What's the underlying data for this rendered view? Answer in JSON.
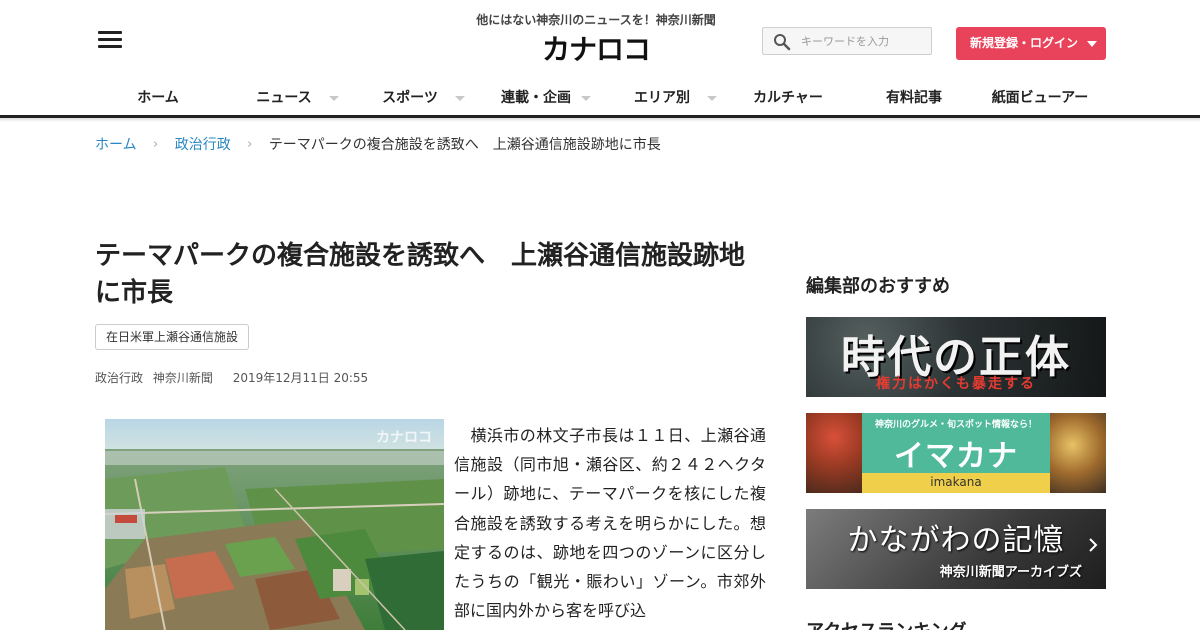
{
  "header": {
    "tagline": "他にはない神奈川のニュースを！神奈川新聞",
    "logo": "カナロコ",
    "search_placeholder": "キーワードを入力",
    "login_label": "新規登録・ログイン"
  },
  "nav": [
    {
      "label": "ホーム",
      "dropdown": false
    },
    {
      "label": "ニュース",
      "dropdown": true
    },
    {
      "label": "スポーツ",
      "dropdown": true
    },
    {
      "label": "連載・企画",
      "dropdown": true
    },
    {
      "label": "エリア別",
      "dropdown": true
    },
    {
      "label": "カルチャー",
      "dropdown": false
    },
    {
      "label": "有料記事",
      "dropdown": false
    },
    {
      "label": "紙面ビューアー",
      "dropdown": false
    }
  ],
  "breadcrumb": {
    "home": "ホーム",
    "category": "政治行政",
    "current": "テーマパークの複合施設を誘致へ　上瀬谷通信施設跡地に市長"
  },
  "article": {
    "title": "テーマパークの複合施設を誘致へ　上瀬谷通信施設跡地に市長",
    "tag": "在日米軍上瀬谷通信施設",
    "category": "政治行政",
    "source": "神奈川新聞",
    "date": "2019年12月11日 20:55",
    "photo_watermark": "カナロコ",
    "body": "　横浜市の林文子市長は１１日、上瀬谷通信施設（同市旭・瀬谷区、約２４２ヘクタール）跡地に、テーマパークを核にした複合施設を誘致する考えを明らかにした。想定するのは、跡地を四つのゾーンに区分したうちの「観光・賑わい」ゾーン。市郊外部に国内外から客を呼び込"
  },
  "sidebar": {
    "heading": "編集部のおすすめ",
    "banner1": {
      "title": "時代の正体",
      "subtitle": "権力はかくも暴走する"
    },
    "banner2": {
      "small": "神奈川のグルメ・旬スポット情報なら！",
      "title": "イマカナ",
      "en": "imakana"
    },
    "banner3": {
      "title": "かながわの記憶",
      "subtitle": "神奈川新聞アーカイブズ"
    },
    "heading2": "アクセスランキング"
  },
  "colors": {
    "accent": "#e8435a",
    "link": "#2a87c3",
    "nav_rule": "#222222"
  }
}
